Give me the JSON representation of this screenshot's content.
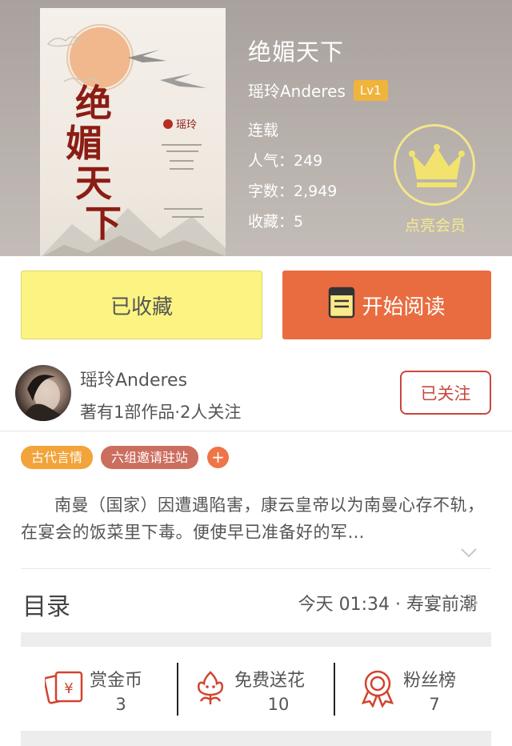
{
  "book": {
    "title": "绝媚天下",
    "author": "瑶玲Anderes",
    "level": "Lv1",
    "status": "连载",
    "popularity": "人气：249",
    "word_count": "字数：2,949",
    "favorites": "收藏：5",
    "cover_title_chars": "绝媚天下",
    "cover_author": "瑶玲"
  },
  "vip": {
    "label": "点亮会员",
    "icon": "crown-icon"
  },
  "actions": {
    "collected_label": "已收藏",
    "read_label": "开始阅读"
  },
  "author_card": {
    "name": "瑶玲Anderes",
    "meta": "著有1部作品·2人关注",
    "follow_label": "已关注"
  },
  "tags": [
    "古代言情",
    "六组邀请驻站"
  ],
  "add_tag_label": "+",
  "synopsis": "南曼（国家）因遭遇陷害，康云皇帝以为南曼心存不轨，在宴会的饭菜里下毒。便使早已准备好的军…",
  "catalog": {
    "label": "目录",
    "latest": "今天 01:34 · 寿宴前潮"
  },
  "stats": [
    {
      "title": "赏金币",
      "value": "3",
      "icon": "reward-coin-icon"
    },
    {
      "title": "免费送花",
      "value": "10",
      "icon": "flower-icon"
    },
    {
      "title": "粉丝榜",
      "value": "7",
      "icon": "medal-icon"
    }
  ],
  "colors": {
    "accent_orange": "#e96c40",
    "collected_yellow": "#fcf482",
    "follow_red": "#c9463d",
    "icon_red": "#d2432f",
    "vip_yellow": "#f1e58a"
  }
}
